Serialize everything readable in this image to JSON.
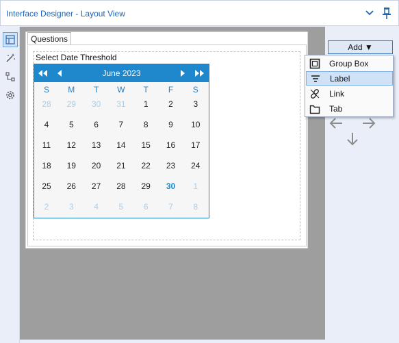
{
  "window": {
    "title": "Interface Designer - Layout View",
    "collapse_icon": "chevron-down-icon",
    "pin_icon": "pin-icon"
  },
  "toolbar": {
    "items": [
      {
        "name": "layout-view-icon",
        "active": true
      },
      {
        "name": "magic-wand-icon",
        "active": false
      },
      {
        "name": "tree-icon",
        "active": false
      },
      {
        "name": "settings-gear-icon",
        "active": false
      }
    ]
  },
  "designer": {
    "tab_label": "Questions",
    "group_label": "Select Date Threshold"
  },
  "calendar": {
    "month_label": "June 2023",
    "weekdays": [
      "S",
      "M",
      "T",
      "W",
      "T",
      "F",
      "S"
    ],
    "weeks": [
      [
        {
          "d": "28",
          "m": true
        },
        {
          "d": "29",
          "m": true
        },
        {
          "d": "30",
          "m": true
        },
        {
          "d": "31",
          "m": true
        },
        {
          "d": "1"
        },
        {
          "d": "2"
        },
        {
          "d": "3"
        }
      ],
      [
        {
          "d": "4"
        },
        {
          "d": "5"
        },
        {
          "d": "6"
        },
        {
          "d": "7"
        },
        {
          "d": "8"
        },
        {
          "d": "9"
        },
        {
          "d": "10"
        }
      ],
      [
        {
          "d": "11"
        },
        {
          "d": "12"
        },
        {
          "d": "13"
        },
        {
          "d": "14"
        },
        {
          "d": "15"
        },
        {
          "d": "16"
        },
        {
          "d": "17"
        }
      ],
      [
        {
          "d": "18"
        },
        {
          "d": "19"
        },
        {
          "d": "20"
        },
        {
          "d": "21"
        },
        {
          "d": "22"
        },
        {
          "d": "23"
        },
        {
          "d": "24"
        }
      ],
      [
        {
          "d": "25"
        },
        {
          "d": "26"
        },
        {
          "d": "27"
        },
        {
          "d": "28"
        },
        {
          "d": "29"
        },
        {
          "d": "30",
          "t": true
        },
        {
          "d": "1",
          "m": true
        }
      ],
      [
        {
          "d": "2",
          "m": true
        },
        {
          "d": "3",
          "m": true
        },
        {
          "d": "4",
          "m": true
        },
        {
          "d": "5",
          "m": true
        },
        {
          "d": "6",
          "m": true
        },
        {
          "d": "7",
          "m": true
        },
        {
          "d": "8",
          "m": true
        }
      ]
    ],
    "colors": {
      "header": "#1f87cc",
      "weekday": "#2a7fc2",
      "muted": "#a9cfe9",
      "today": "#1f87cc"
    }
  },
  "add_menu": {
    "button_label": "Add ▼",
    "items": [
      {
        "label": "Group Box",
        "icon": "group-box-icon",
        "selected": false
      },
      {
        "label": "Label",
        "icon": "label-icon",
        "selected": true
      },
      {
        "label": "Link",
        "icon": "link-icon",
        "selected": false
      },
      {
        "label": "Tab",
        "icon": "tab-folder-icon",
        "selected": false
      }
    ]
  },
  "move_arrows": [
    "arrow-left-icon",
    "arrow-right-icon",
    "arrow-down-icon"
  ]
}
